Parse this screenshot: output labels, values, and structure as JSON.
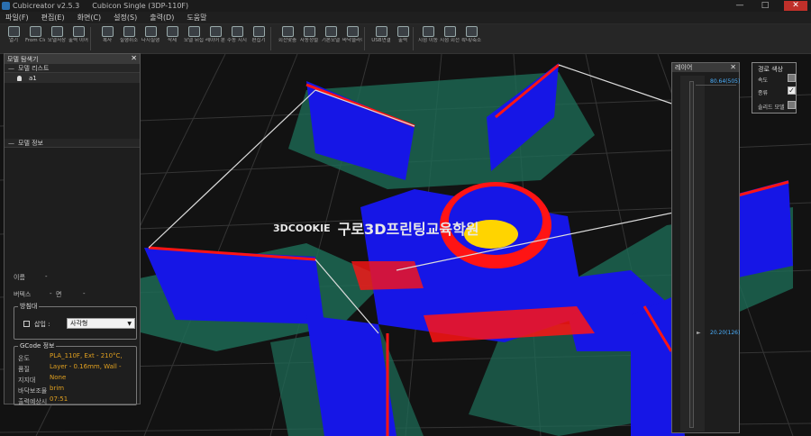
{
  "titlebar": {
    "app": "Cubicreator v2.5.3",
    "printer": "Cubicon Single (3DP-110F)",
    "minimize": "—",
    "maximize": "□",
    "close": "✕"
  },
  "menu": [
    "파일(F)",
    "편집(E)",
    "화면(C)",
    "설정(S)",
    "출력(D)",
    "도움말"
  ],
  "toolbar": [
    {
      "label": "열기",
      "icon": "open-icon"
    },
    {
      "label": "From Cloud",
      "icon": "cloud-icon"
    },
    {
      "label": "모델저장",
      "icon": "save-icon"
    },
    {
      "label": "출력 이어",
      "icon": "resume-icon"
    },
    {
      "label": "복사",
      "icon": "copy-icon"
    },
    {
      "label": "실행취소",
      "icon": "undo-icon"
    },
    {
      "label": "다시실행",
      "icon": "redo-icon"
    },
    {
      "label": "삭제",
      "icon": "delete-icon"
    },
    {
      "label": "모델 뒤집기",
      "icon": "flip-icon"
    },
    {
      "label": "레이어 분할",
      "icon": "split-icon"
    },
    {
      "label": "수동 지지대",
      "icon": "support-icon"
    },
    {
      "label": "편집기",
      "icon": "editor-icon"
    },
    {
      "label": "회전맞춤",
      "icon": "rotate-icon"
    },
    {
      "label": "자동정렬",
      "icon": "arrange-icon"
    },
    {
      "label": "기본모델",
      "icon": "cube-icon"
    },
    {
      "label": "바닥슬라이스",
      "icon": "slice-icon"
    },
    {
      "label": "USB연결",
      "icon": "usb-icon"
    },
    {
      "label": "출력",
      "icon": "print-icon"
    },
    {
      "label": "시점 이동",
      "icon": "move-view-icon"
    },
    {
      "label": "시점 회전",
      "icon": "rotate-view-icon"
    },
    {
      "label": "확대/축소",
      "icon": "zoom-icon"
    }
  ],
  "watermark": {
    "brand": "3DCOOKIE",
    "text": "구로3D프린팅교육학원"
  },
  "explorer": {
    "title": "모델 탐색기",
    "model_list_title": "모델 리스트",
    "model_name": "a1",
    "model_info_title": "모델 정보",
    "name_label": "이름",
    "name_value": "-",
    "vertex_label": "버텍스",
    "vertex_value": "-",
    "face_label": "면",
    "face_value": "-",
    "attach_legend": "방침대",
    "attach_checkbox_label": "삽입 :",
    "attach_select": "사각형",
    "gcode_legend": "GCode 정보",
    "gcode": [
      {
        "k": "온도",
        "v": "PLA_110F, Ext - 210°C,"
      },
      {
        "k": "품질",
        "v": "Layer - 0.16mm, Wall -"
      },
      {
        "k": "지지대",
        "v": "None"
      },
      {
        "k": "바닥보조물",
        "v": "brim"
      },
      {
        "k": "출력예상시",
        "v": "07:51"
      }
    ]
  },
  "layer_panel": {
    "title": "레이어",
    "top_label": "80.64(505)",
    "mid_label": "20.20(126)",
    "top_value": 505,
    "mid_value": 126
  },
  "path_color": {
    "title": "경로 색상",
    "speed": "속도",
    "type": "종류",
    "solid_model": "솔리드 모델",
    "speed_checked": false,
    "type_checked": true,
    "solid_checked": false
  },
  "colors": {
    "perimeter": "#1616e6",
    "outer": "#ff1414",
    "infill": "#ffd400",
    "brim": "#1fa07a",
    "grid": "#3a3a3a"
  }
}
